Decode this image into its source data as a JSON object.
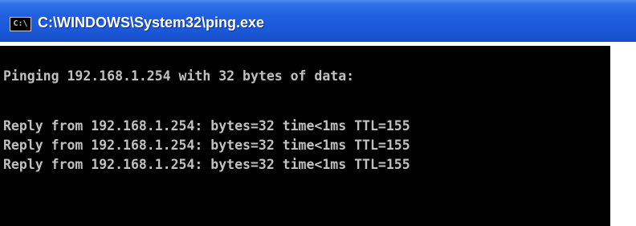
{
  "window": {
    "title": "C:\\WINDOWS\\System32\\ping.exe",
    "icon": "console-app-icon",
    "icon_glyph": "C:\\"
  },
  "console": {
    "lines": [
      "Pinging 192.168.1.254 with 32 bytes of data:",
      "Reply from 192.168.1.254: bytes=32 time<1ms TTL=155",
      "Reply from 192.168.1.254: bytes=32 time<1ms TTL=155",
      "Reply from 192.168.1.254: bytes=32 time<1ms TTL=155"
    ]
  },
  "colors": {
    "titlebar": "#1f5fe0",
    "console_background": "#000000",
    "console_text": "#c0c0c0"
  }
}
